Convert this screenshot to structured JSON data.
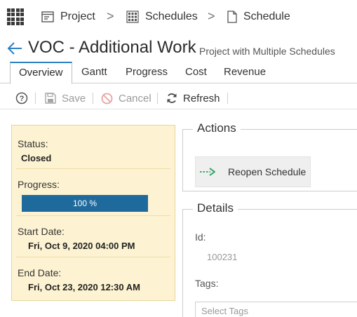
{
  "breadcrumb": {
    "items": [
      {
        "label": "Project",
        "icon": "project-icon"
      },
      {
        "label": "Schedules",
        "icon": "schedules-grid-icon"
      },
      {
        "label": "Schedule",
        "icon": "document-icon"
      }
    ],
    "separator": ">"
  },
  "header": {
    "title": "VOC - Additional Work",
    "subtitle": "Project with Multiple Schedules"
  },
  "tabs": [
    {
      "label": "Overview",
      "active": true
    },
    {
      "label": "Gantt",
      "active": false
    },
    {
      "label": "Progress",
      "active": false
    },
    {
      "label": "Cost",
      "active": false
    },
    {
      "label": "Revenue",
      "active": false
    }
  ],
  "toolbar": {
    "save_label": "Save",
    "cancel_label": "Cancel",
    "refresh_label": "Refresh"
  },
  "status_panel": {
    "status_label": "Status:",
    "status_value": "Closed",
    "progress_label": "Progress:",
    "progress_text": "100 %",
    "progress_percent": 100,
    "start_label": "Start Date:",
    "start_value": "Fri, Oct 9, 2020 04:00 PM",
    "end_label": "End Date:",
    "end_value": "Fri, Oct 23, 2020 12:30 AM"
  },
  "actions": {
    "legend": "Actions",
    "reopen_label": "Reopen Schedule"
  },
  "details": {
    "legend": "Details",
    "id_label": "Id:",
    "id_value": "100231",
    "tags_label": "Tags:",
    "tags_placeholder": "Select Tags"
  },
  "colors": {
    "accent": "#2b7fc4",
    "progress": "#1f6a9c",
    "panel_bg": "#fdf3d2",
    "reopen_arrow": "#3aa76d"
  }
}
